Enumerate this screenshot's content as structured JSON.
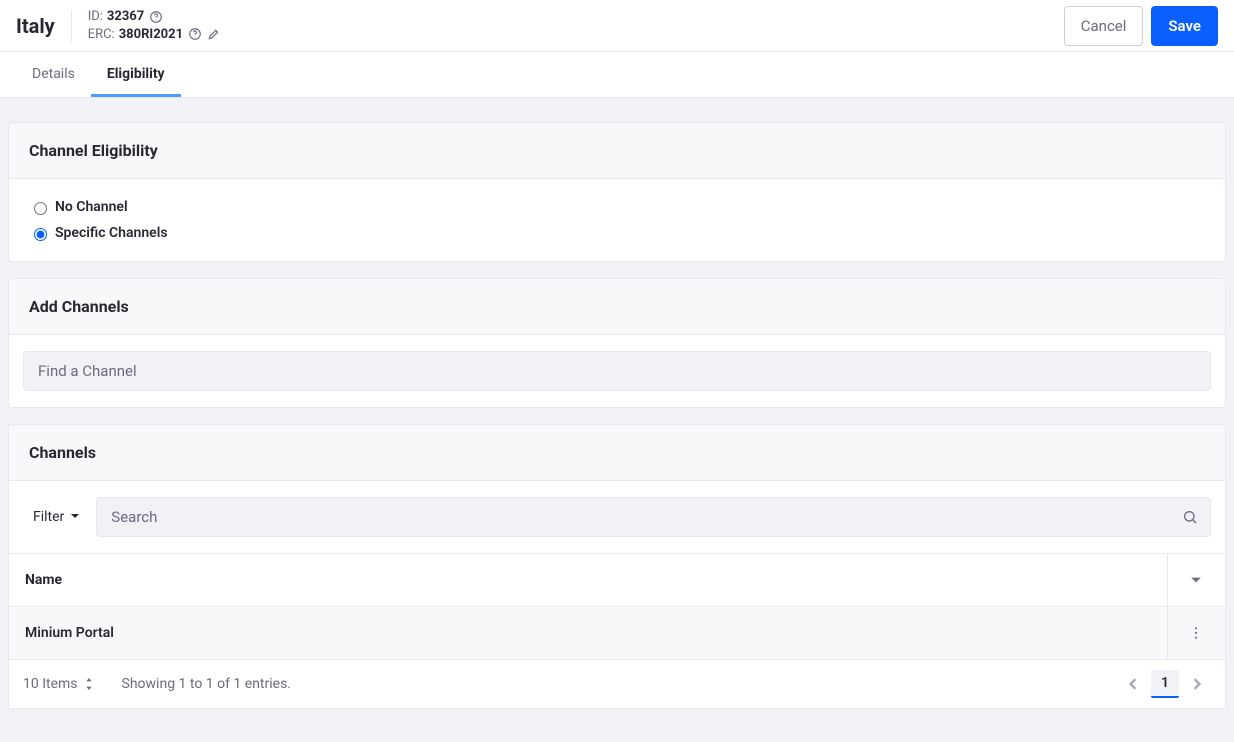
{
  "header": {
    "title": "Italy",
    "id_label": "ID:",
    "id_value": "32367",
    "erc_label": "ERC:",
    "erc_value": "380RI2021",
    "cancel_label": "Cancel",
    "save_label": "Save"
  },
  "tabs": {
    "details": "Details",
    "eligibility": "Eligibility"
  },
  "channel_eligibility": {
    "title": "Channel Eligibility",
    "no_channel_label": "No Channel",
    "specific_channels_label": "Specific Channels"
  },
  "add_channels": {
    "title": "Add Channels",
    "placeholder": "Find a Channel"
  },
  "channels": {
    "title": "Channels",
    "filter_label": "Filter",
    "search_placeholder": "Search",
    "col_name": "Name",
    "rows": [
      {
        "name": "Minium Portal"
      }
    ],
    "page_size_label": "10 Items",
    "showing_label": "Showing 1 to 1 of 1 entries.",
    "current_page": "1"
  }
}
